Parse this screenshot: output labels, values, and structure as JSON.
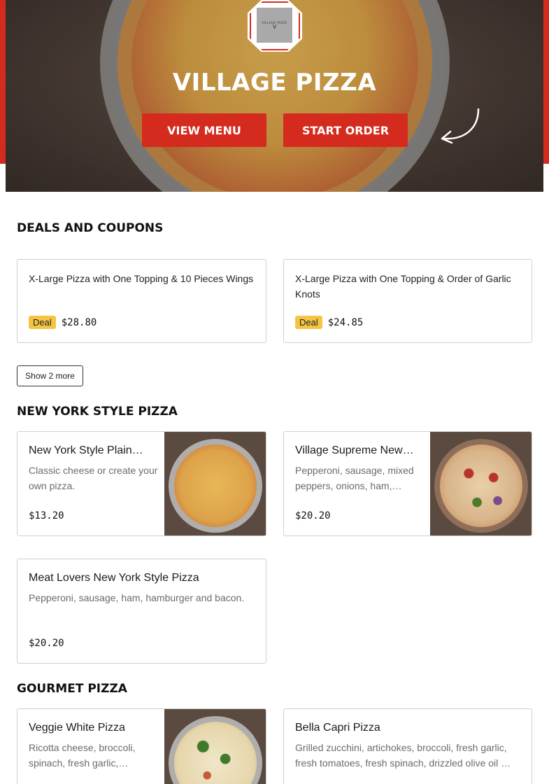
{
  "hero": {
    "title": "VILLAGE PIZZA",
    "logo_text": "VILLAGE PIZZA",
    "logo_letter": "V",
    "view_menu_label": "VIEW MENU",
    "start_order_label": "START ORDER"
  },
  "deals": {
    "title": "DEALS AND COUPONS",
    "items": [
      {
        "name": "X-Large Pizza with One Topping & 10 Pieces Wings",
        "badge": "Deal",
        "price": "$28.80"
      },
      {
        "name": "X-Large Pizza with One Topping & Order of Garlic Knots",
        "badge": "Deal",
        "price": "$24.85"
      }
    ],
    "show_more_label": "Show 2 more"
  },
  "ny_pizza": {
    "title": "NEW YORK STYLE PIZZA",
    "items": [
      {
        "name": "New York Style Plain…",
        "desc": "Classic cheese or create your own pizza.",
        "price": "$13.20"
      },
      {
        "name": "Village Supreme New…",
        "desc": "Pepperoni, sausage, mixed peppers, onions, ham,…",
        "price": "$20.20"
      },
      {
        "name": "Meat Lovers New York Style Pizza",
        "desc": "Pepperoni, sausage, ham, hamburger and bacon.",
        "price": "$20.20"
      }
    ]
  },
  "gourmet": {
    "title": "GOURMET PIZZA",
    "items": [
      {
        "name": "Veggie White Pizza",
        "desc": "Ricotta cheese, broccoli, spinach, fresh garlic,…"
      },
      {
        "name": "Bella Capri Pizza",
        "desc": "Grilled zucchini, artichokes, broccoli, fresh garlic, fresh tomatoes, fresh spinach, drizzled olive oil …"
      }
    ]
  },
  "colors": {
    "brand_red": "#d52b1e",
    "deal_yellow": "#f5c542"
  }
}
